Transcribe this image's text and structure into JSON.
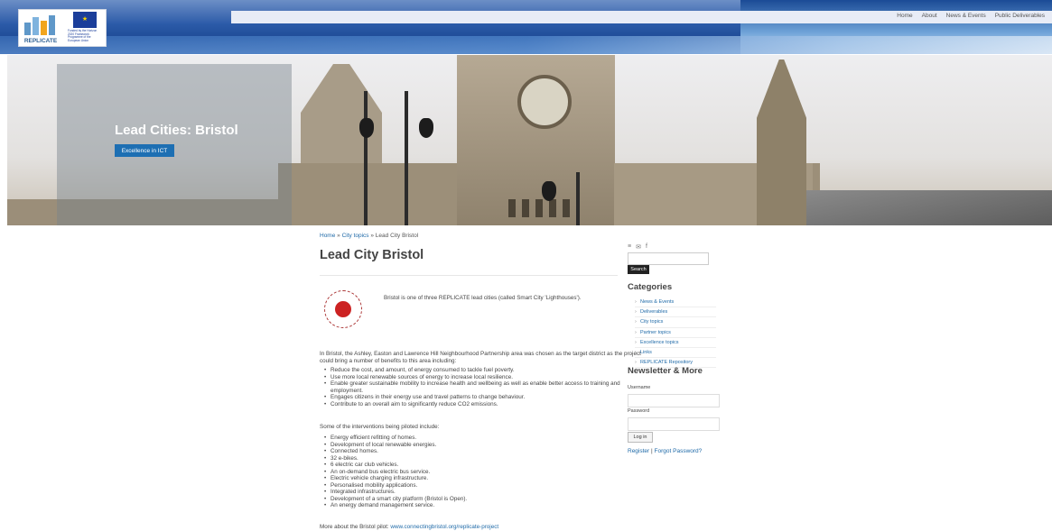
{
  "header": {
    "logo_word": "REPLICATE",
    "eu_text": "Funded by the Horizon 2020 Framework Programme of the European Union",
    "nav": [
      "Home",
      "About",
      "News & Events",
      "Public Deliverables"
    ]
  },
  "hero": {
    "title": "Lead Cities: Bristol",
    "button": "Excellence in ICT"
  },
  "breadcrumb": {
    "home": "Home",
    "sep1": " » ",
    "topics": "City topics",
    "sep2": " » ",
    "current": "Lead City Bristol"
  },
  "page": {
    "title": "Lead City Bristol",
    "intro": "Bristol is one of three REPLICATE lead cities (called Smart City 'Lighthouses').",
    "para1": "In Bristol, the Ashley, Easton and Lawrence Hill Neighbourhood Partnership area was chosen as the target district as the project could bring a number of benefits to this area including:",
    "benefits": [
      "Reduce the cost, and amount, of energy consumed to tackle fuel poverty.",
      "Use more local renewable sources of energy to increase local resilience.",
      "Enable greater sustainable mobility to increase health and wellbeing as well as enable better access to training and employment.",
      "Engages citizens in their energy use and travel patterns to change behaviour.",
      "Contribute to an overall aim to significantly reduce CO2 emissions."
    ],
    "para2": "Some of the interventions being piloted include:",
    "interventions": [
      "Energy efficient refitting of homes.",
      "Development of local renewable energies.",
      "Connected homes.",
      "32 e-bikes.",
      "6 electric car club vehicles.",
      "An on-demand bus electric bus service.",
      "Electric vehicle charging infrastructure.",
      "Personalised mobility applications.",
      "Integrated infrastructures.",
      "Development of a smart city platform (Bristol is Open).",
      "An energy demand management service."
    ],
    "more_label": "More about the Bristol pilot: ",
    "more_link": "www.connectingbristol.org/replicate-project"
  },
  "sidebar": {
    "social_icons": [
      "rss-icon",
      "mail-icon",
      "facebook-icon"
    ],
    "social_glyphs": [
      "≡",
      "✉",
      "f"
    ],
    "search_button": "Search",
    "categories_title": "Categories",
    "categories": [
      "News & Events",
      "Deliverables",
      "City topics",
      "Partner topics",
      "Excellence topics",
      "Links",
      "REPLICATE Repository"
    ],
    "newsletter_title": "Newsletter & More",
    "username_label": "Username",
    "password_label": "Password",
    "login_button": "Log in",
    "register": "Register",
    "sep": " | ",
    "forgot": "Forgot Password?"
  }
}
